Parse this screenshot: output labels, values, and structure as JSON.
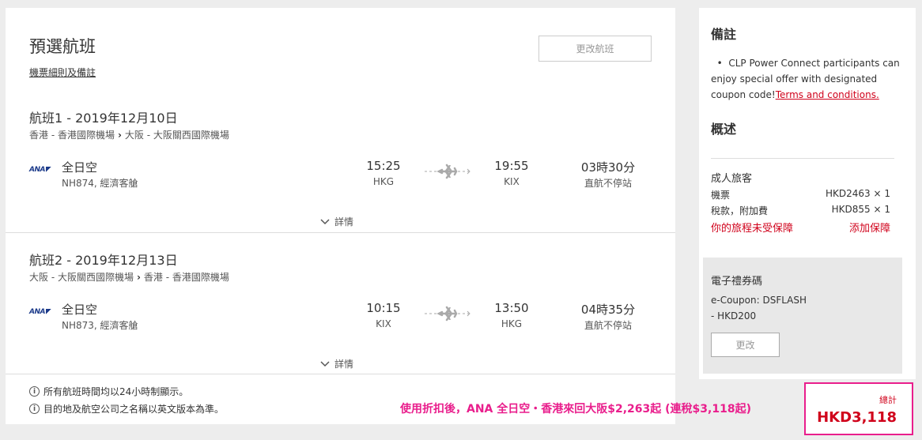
{
  "main": {
    "title": "預選航班",
    "rules_link": "機票細則及備註",
    "change_flight_button": "更改航班",
    "details_label": "詳情",
    "flights": [
      {
        "title": "航班1 - 2019年12月10日",
        "origin": "香港 - 香港國際機場",
        "destination": "大阪 - 大阪關西國際機場",
        "airline_logo": "ANA",
        "airline": "全日空",
        "flight_info": "NH874, 經濟客艙",
        "dep_time": "15:25",
        "dep_code": "HKG",
        "arr_time": "19:55",
        "arr_code": "KIX",
        "duration": "03時30分",
        "stops": "直航不停站"
      },
      {
        "title": "航班2 - 2019年12月13日",
        "origin": "大阪 - 大阪關西國際機場",
        "destination": "香港 - 香港國際機場",
        "airline_logo": "ANA",
        "airline": "全日空",
        "flight_info": "NH873, 經濟客艙",
        "dep_time": "10:15",
        "dep_code": "KIX",
        "arr_time": "13:50",
        "arr_code": "HKG",
        "duration": "04時35分",
        "stops": "直航不停站"
      }
    ],
    "notes": [
      "所有航班時間均以24小時制顯示。",
      "目的地及航空公司之名稱以英文版本為準。"
    ]
  },
  "sidebar": {
    "remarks_heading": "備註",
    "remark_text": "CLP Power Connect participants can enjoy special offer with designated coupon code!",
    "remark_link": "Terms and conditions.",
    "summary_heading": "概述",
    "passenger_type": "成人旅客",
    "fare_label": "機票",
    "fare_value": "HKD2463 × 1",
    "tax_label": "稅款，附加費",
    "tax_value": "HKD855 × 1",
    "protection_status": "你的旅程未受保障",
    "add_protection": "添加保障",
    "ecoupon": {
      "title": "電子禮券碼",
      "code": "e-Coupon: DSFLASH",
      "amount": "- HKD200",
      "change_button": "更改"
    }
  },
  "promo_text": "使用折扣後，ANA 全日空・香港來回大阪$2,263起 (連稅$3,118起)",
  "total": {
    "label": "總計",
    "value": "HKD3,118"
  },
  "colors": {
    "accent_red": "#d0021b",
    "promo_pink": "#e91e8c",
    "airline_blue": "#1b3a8a"
  }
}
